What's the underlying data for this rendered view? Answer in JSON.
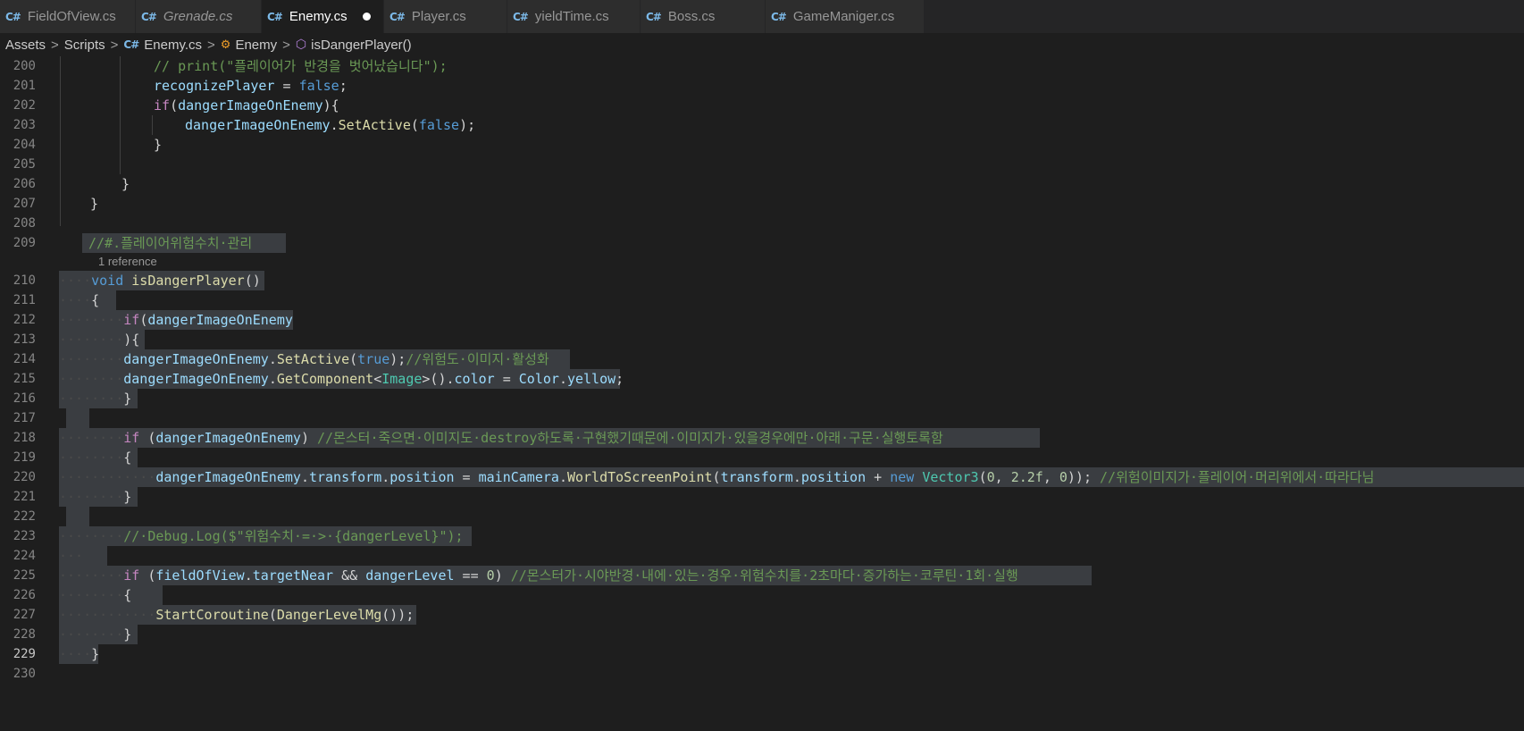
{
  "tabs": [
    {
      "label": "FieldOfView.cs",
      "icon": "csharp-file-icon",
      "italic": false,
      "active": false
    },
    {
      "label": "Grenade.cs",
      "icon": "csharp-file-icon",
      "italic": true,
      "active": false
    },
    {
      "label": "Enemy.cs",
      "icon": "csharp-file-icon",
      "italic": false,
      "active": true,
      "dirty": true
    },
    {
      "label": "Player.cs",
      "icon": "csharp-file-icon",
      "italic": false,
      "active": false
    },
    {
      "label": "yieldTime.cs",
      "icon": "csharp-file-icon",
      "italic": false,
      "active": false
    },
    {
      "label": "Boss.cs",
      "icon": "csharp-file-icon",
      "italic": false,
      "active": false
    },
    {
      "label": "GameManiger.cs",
      "icon": "csharp-file-icon",
      "italic": false,
      "active": false
    }
  ],
  "tab_icon_glyph": "C#",
  "breadcrumb": {
    "assets": "Assets",
    "scripts": "Scripts",
    "file": "Enemy.cs",
    "class": "Enemy",
    "method": "isDangerPlayer()",
    "sep": ">"
  },
  "codelens": "1 reference",
  "lines": [
    {
      "n": "200"
    },
    {
      "n": "201"
    },
    {
      "n": "202"
    },
    {
      "n": "203"
    },
    {
      "n": "204"
    },
    {
      "n": "205"
    },
    {
      "n": "206"
    },
    {
      "n": "207"
    },
    {
      "n": "208"
    },
    {
      "n": "209"
    },
    {
      "n": "210"
    },
    {
      "n": "211"
    },
    {
      "n": "212"
    },
    {
      "n": "213"
    },
    {
      "n": "214"
    },
    {
      "n": "215"
    },
    {
      "n": "216"
    },
    {
      "n": "217"
    },
    {
      "n": "218"
    },
    {
      "n": "219"
    },
    {
      "n": "220"
    },
    {
      "n": "221"
    },
    {
      "n": "222"
    },
    {
      "n": "223"
    },
    {
      "n": "224"
    },
    {
      "n": "225"
    },
    {
      "n": "226"
    },
    {
      "n": "227"
    },
    {
      "n": "228"
    },
    {
      "n": "229"
    },
    {
      "n": "230"
    }
  ],
  "code": {
    "l200_comment": "// print(\"플레이어가 반경을 벗어났습니다\");",
    "l201_id": "recognizePlayer",
    "l201_eq": " = ",
    "l201_false": "false",
    "l201_end": ";",
    "l202_if": "if",
    "l202_open": "(",
    "l202_id": "dangerImageOnEnemy",
    "l202_close": "){",
    "l203_id": "dangerImageOnEnemy",
    "l203_dot": ".",
    "l203_fn": "SetActive",
    "l203_open": "(",
    "l203_false": "false",
    "l203_close": ");",
    "l204": "}",
    "l206": "}",
    "l207": "}",
    "l209_comment": "//#.플레이어위험수치·관리",
    "l210_void": "void",
    "l210_fn": "isDangerPlayer",
    "l210_parens": "()",
    "l211": "{",
    "l212_if": "if",
    "l212_open": "(",
    "l212_id": "dangerImageOnEnemy",
    "l213": "){",
    "l214_id": "dangerImageOnEnemy",
    "l214_dot": ".",
    "l214_fn": "SetActive",
    "l214_open": "(",
    "l214_true": "true",
    "l214_close": ");",
    "l214_comment": "//위험도·이미지·활성화",
    "l215_id": "dangerImageOnEnemy",
    "l215_dot": ".",
    "l215_fn": "GetComponent",
    "l215_lt": "<",
    "l215_ty": "Image",
    "l215_gt": ">().",
    "l215_color": "color",
    "l215_eq": " = ",
    "l215_cty": "Color",
    "l215_dot2": ".",
    "l215_yellow": "yellow",
    "l215_end": ";",
    "l216": "}",
    "l218_if": "if",
    "l218_open": " (",
    "l218_id": "dangerImageOnEnemy",
    "l218_close": ") ",
    "l218_comment": "//몬스터·죽으면·이미지도·destroy하도록·구현했기때문에·이미지가·있을경우에만·아래·구문·실행토록함",
    "l219": "{",
    "l220_id1": "dangerImageOnEnemy",
    "l220_p1": ".",
    "l220_id2": "transform",
    "l220_p2": ".",
    "l220_id3": "position",
    "l220_eq": " = ",
    "l220_id4": "mainCamera",
    "l220_p3": ".",
    "l220_fn": "WorldToScreenPoint",
    "l220_open": "(",
    "l220_id5": "transform",
    "l220_p4": ".",
    "l220_id6": "position",
    "l220_plus": " + ",
    "l220_new": "new",
    "l220_sp": " ",
    "l220_ty": "Vector3",
    "l220_open2": "(",
    "l220_n1": "0",
    "l220_c1": ", ",
    "l220_n2": "2.2f",
    "l220_c2": ", ",
    "l220_n3": "0",
    "l220_close": ")); ",
    "l220_comment": "//위험이미지가·플레이어·머리위에서·따라다님",
    "l221": "}",
    "l223_comment": "//·Debug.Log($\"위험수치·=·>·{dangerLevel}\");",
    "l225_if": "if",
    "l225_open": " (",
    "l225_id1": "fieldOfView",
    "l225_dot": ".",
    "l225_id2": "targetNear",
    "l225_and": " && ",
    "l225_id3": "dangerLevel",
    "l225_eq": " == ",
    "l225_num": "0",
    "l225_close": ") ",
    "l225_comment": "//몬스터가·시야반경·내에·있는·경우·위험수치를·2초마다·증가하는·코루틴·1회·실행",
    "l226": "{",
    "l227_fn": "StartCoroutine",
    "l227_open": "(",
    "l227_fn2": "DangerLevelMg",
    "l227_close": "());",
    "l228": "}",
    "l229": "}",
    "ws_dots6": "······",
    "ws_dots4": "····",
    "ws_dots8": "········",
    "ws_dots3": "···",
    "ws_dots10": "··········"
  },
  "colors": {
    "background": "#1e1e1e",
    "selection": "#3a3d41",
    "keyword": "#569cd6",
    "control": "#c586c0",
    "identifier": "#9cdcfe",
    "function": "#dcdcaa",
    "type": "#4ec9b0",
    "number": "#b5cea8",
    "comment": "#6a9955"
  }
}
